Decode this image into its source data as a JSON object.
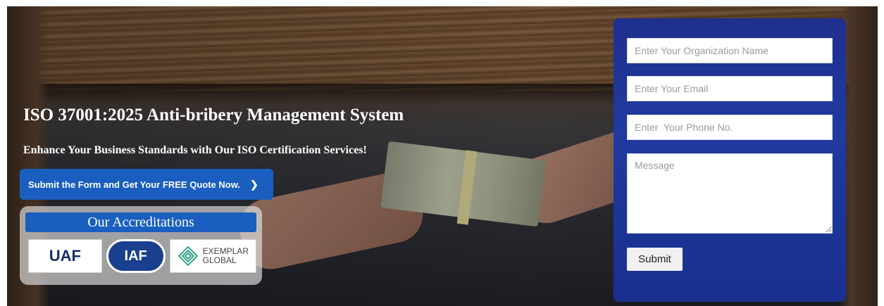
{
  "hero": {
    "title": "ISO 37001:2025 Anti-bribery Management System",
    "subtitle": "Enhance Your Business Standards with Our ISO Certification Services!",
    "cta_label": "Submit the Form and Get Your FREE Quote Now.",
    "cta_icon": "chevron-right-icon"
  },
  "accreditations": {
    "title": "Our Accreditations",
    "logos": [
      "UAF",
      "IAF",
      "EXEMPLAR GLOBAL"
    ],
    "logo_uaf": "UAF",
    "logo_iaf": "IAF",
    "logo_ex_line1": "EXEMPLAR",
    "logo_ex_line2": "GLOBAL"
  },
  "form": {
    "org_placeholder": "Enter Your Organization Name",
    "email_placeholder": "Enter Your Email",
    "phone_placeholder": "Enter  Your Phone No.",
    "message_placeholder": "Message",
    "submit_label": "Submit"
  },
  "colors": {
    "cta_blue": "#1a5fbf",
    "form_blue": "#2035a0",
    "white": "#ffffff"
  }
}
